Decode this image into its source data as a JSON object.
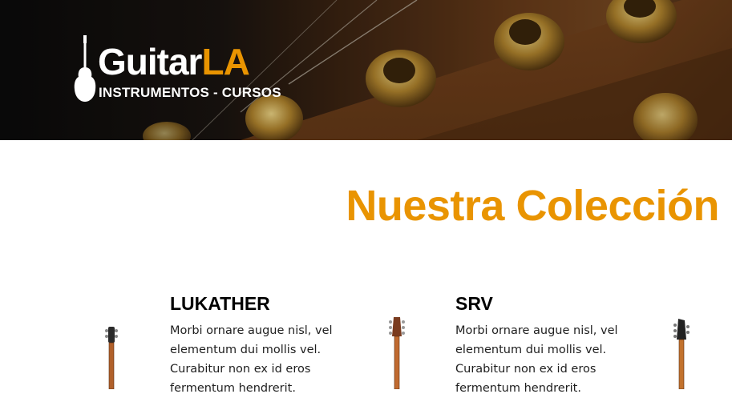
{
  "header": {
    "logo": {
      "title_main": "Guitar",
      "title_accent": "LA",
      "subtitle": "INSTRUMENTOS - CURSOS"
    }
  },
  "main": {
    "title": "Nuestra Colección",
    "products": [
      {
        "name": "LUKATHER",
        "description": "Morbi ornare augue nisl, vel elementum dui mollis vel. Curabitur non ex id eros fermentum hendrerit."
      },
      {
        "name": "SRV",
        "description": "Morbi ornare augue nisl, vel elementum dui mollis vel. Curabitur non ex id eros fermentum hendrerit."
      }
    ]
  },
  "colors": {
    "accent": "#e99401",
    "header_dark": "#0b0b0b",
    "text": "#000000"
  }
}
